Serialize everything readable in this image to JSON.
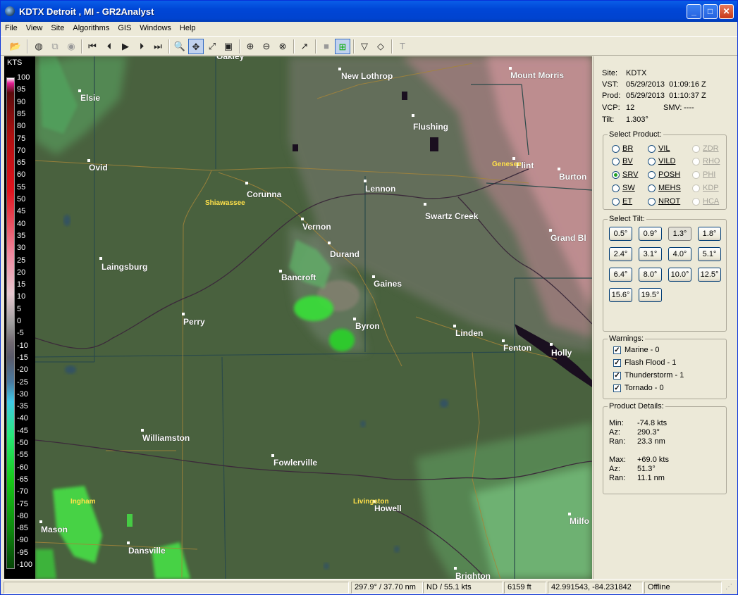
{
  "window": {
    "title": "KDTX Detroit , MI - GR2Analyst",
    "minimize": "_",
    "maximize": "□",
    "close": "✕"
  },
  "menu": [
    "File",
    "View",
    "Site",
    "Algorithms",
    "GIS",
    "Windows",
    "Help"
  ],
  "toolbar_icons": [
    "open-folder-icon",
    "globe-icon",
    "copy-icon",
    "export-icon",
    "first-frame-icon",
    "prev-frame-icon",
    "play-icon",
    "next-frame-icon",
    "last-frame-icon",
    "zoom-icon",
    "pan-icon",
    "measure-icon",
    "layers-icon",
    "zoom-in-icon",
    "zoom-out-icon",
    "zoom-reset-icon",
    "cross-section-icon",
    "volume-icon",
    "mode-icon",
    "triangle-icon",
    "diamond-icon",
    "text-icon"
  ],
  "scale": {
    "unit": "KTS",
    "ticks": [
      "100",
      "95",
      "90",
      "85",
      "80",
      "75",
      "70",
      "65",
      "60",
      "55",
      "50",
      "45",
      "40",
      "35",
      "30",
      "25",
      "20",
      "15",
      "10",
      "5",
      "0",
      "-5",
      "-10",
      "-15",
      "-20",
      "-25",
      "-30",
      "-35",
      "-40",
      "-45",
      "-50",
      "-55",
      "-60",
      "-65",
      "-70",
      "-75",
      "-80",
      "-85",
      "-90",
      "-95",
      "-100"
    ]
  },
  "map": {
    "cities": [
      {
        "name": "Oakley"
      },
      {
        "name": "New Lothrop"
      },
      {
        "name": "Mount Morris"
      },
      {
        "name": "Elsie"
      },
      {
        "name": "Flushing"
      },
      {
        "name": "Ovid"
      },
      {
        "name": "Flint"
      },
      {
        "name": "Burton"
      },
      {
        "name": "Corunna"
      },
      {
        "name": "Lennon"
      },
      {
        "name": "Swartz Creek"
      },
      {
        "name": "Vernon"
      },
      {
        "name": "Grand Bl"
      },
      {
        "name": "Durand"
      },
      {
        "name": "Laingsburg"
      },
      {
        "name": "Bancroft"
      },
      {
        "name": "Gaines"
      },
      {
        "name": "Perry"
      },
      {
        "name": "Byron"
      },
      {
        "name": "Linden"
      },
      {
        "name": "Fenton"
      },
      {
        "name": "Holly"
      },
      {
        "name": "Williamston"
      },
      {
        "name": "Fowlerville"
      },
      {
        "name": "Howell"
      },
      {
        "name": "Mason"
      },
      {
        "name": "Milfo"
      },
      {
        "name": "Dansville"
      },
      {
        "name": "Brighton"
      }
    ],
    "counties": [
      "Shiawassee",
      "Genesee",
      "Ingham",
      "Livingston"
    ]
  },
  "panel": {
    "site": {
      "label": "Site:",
      "value": "KDTX"
    },
    "vst": {
      "label": "VST:",
      "value": "05/29/2013  01:09:16 Z"
    },
    "prod": {
      "label": "Prod:",
      "value": "05/29/2013  01:10:37 Z"
    },
    "vcp": {
      "label": "VCP:",
      "value": "12"
    },
    "smv": {
      "label": "SMV:",
      "value": "----"
    },
    "tilt": {
      "label": "Tilt:",
      "value": "1.303°"
    },
    "select_product": {
      "legend": "Select Product:",
      "items": [
        {
          "label": "BR",
          "enabled": true,
          "selected": false
        },
        {
          "label": "VIL",
          "enabled": true,
          "selected": false
        },
        {
          "label": "ZDR",
          "enabled": false,
          "selected": false
        },
        {
          "label": "BV",
          "enabled": true,
          "selected": false
        },
        {
          "label": "VILD",
          "enabled": true,
          "selected": false
        },
        {
          "label": "RHO",
          "enabled": false,
          "selected": false
        },
        {
          "label": "SRV",
          "enabled": true,
          "selected": true
        },
        {
          "label": "POSH",
          "enabled": true,
          "selected": false
        },
        {
          "label": "PHI",
          "enabled": false,
          "selected": false
        },
        {
          "label": "SW",
          "enabled": true,
          "selected": false
        },
        {
          "label": "MEHS",
          "enabled": true,
          "selected": false
        },
        {
          "label": "KDP",
          "enabled": false,
          "selected": false
        },
        {
          "label": "ET",
          "enabled": true,
          "selected": false
        },
        {
          "label": "NROT",
          "enabled": true,
          "selected": false
        },
        {
          "label": "HCA",
          "enabled": false,
          "selected": false
        }
      ]
    },
    "select_tilt": {
      "legend": "Select Tilt:",
      "selected": "1.3°",
      "items": [
        "0.5°",
        "0.9°",
        "1.3°",
        "1.8°",
        "2.4°",
        "3.1°",
        "4.0°",
        "5.1°",
        "6.4°",
        "8.0°",
        "10.0°",
        "12.5°",
        "15.6°",
        "19.5°"
      ]
    },
    "warnings": {
      "legend": "Warnings:",
      "items": [
        {
          "label": "Marine - 0",
          "checked": true
        },
        {
          "label": "Flash Flood - 1",
          "checked": true
        },
        {
          "label": "Thunderstorm - 1",
          "checked": true
        },
        {
          "label": "Tornado - 0",
          "checked": true
        }
      ]
    },
    "product_details": {
      "legend": "Product Details:",
      "min": {
        "label": "Min:",
        "value": "-74.8 kts"
      },
      "min_az": {
        "label": "Az:",
        "value": "290.3°"
      },
      "min_ran": {
        "label": "Ran:",
        "value": "23.3 nm"
      },
      "max": {
        "label": "Max:",
        "value": "+69.0 kts"
      },
      "max_az": {
        "label": "Az:",
        "value": "51.3°"
      },
      "max_ran": {
        "label": "Ran:",
        "value": "11.1 nm"
      }
    }
  },
  "status": {
    "azran": "297.9° / 37.70 nm",
    "value": "ND / 55.1 kts",
    "height": "6159 ft",
    "latlon": "42.991543, -84.231842",
    "mode": "Offline"
  }
}
